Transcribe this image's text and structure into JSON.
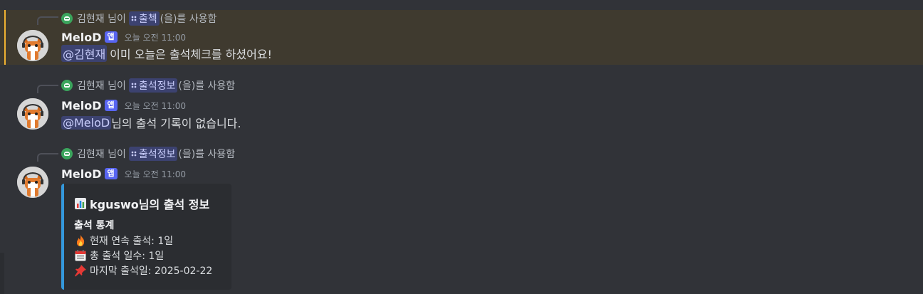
{
  "messages": [
    {
      "reply": {
        "user": "김현재",
        "verb": "님이",
        "command": "출첵",
        "suffix": "(을)를 사용함"
      },
      "username": "MeloD",
      "badge": "앱",
      "timestamp": "오늘 오전 11:00",
      "mention": "@김현재",
      "text": "이미 오늘은 출석체크를 하셨어요!"
    },
    {
      "reply": {
        "user": "김현재",
        "verb": "님이",
        "command": "출석정보",
        "suffix": "(을)를 사용함"
      },
      "username": "MeloD",
      "badge": "앱",
      "timestamp": "오늘 오전 11:00",
      "mention": "@MeloD",
      "text": "님의 출석 기록이 없습니다."
    },
    {
      "reply": {
        "user": "김현재",
        "verb": "님이",
        "command": "출석정보",
        "suffix": "(을)를 사용함"
      },
      "username": "MeloD",
      "badge": "앱",
      "timestamp": "오늘 오전 11:00",
      "embed": {
        "title": "kguswo님의 출석 정보",
        "title_icon": "bar-chart-icon",
        "field_name": "출석 통계",
        "lines": [
          {
            "icon": "fire-icon",
            "text": "현재 연속 출석: 1일"
          },
          {
            "icon": "calendar-icon",
            "text": "총 출석 일수: 1일"
          },
          {
            "icon": "pushpin-icon",
            "text": "마지막 출석일: 2025-02-22"
          }
        ],
        "accent": "#3498db"
      }
    }
  ],
  "colors": {
    "background": "#313338",
    "highlight_bg": "#3f3a2f",
    "highlight_bar": "#f0b232",
    "app_badge": "#5865f2",
    "mention_bg": "#3c4270"
  }
}
